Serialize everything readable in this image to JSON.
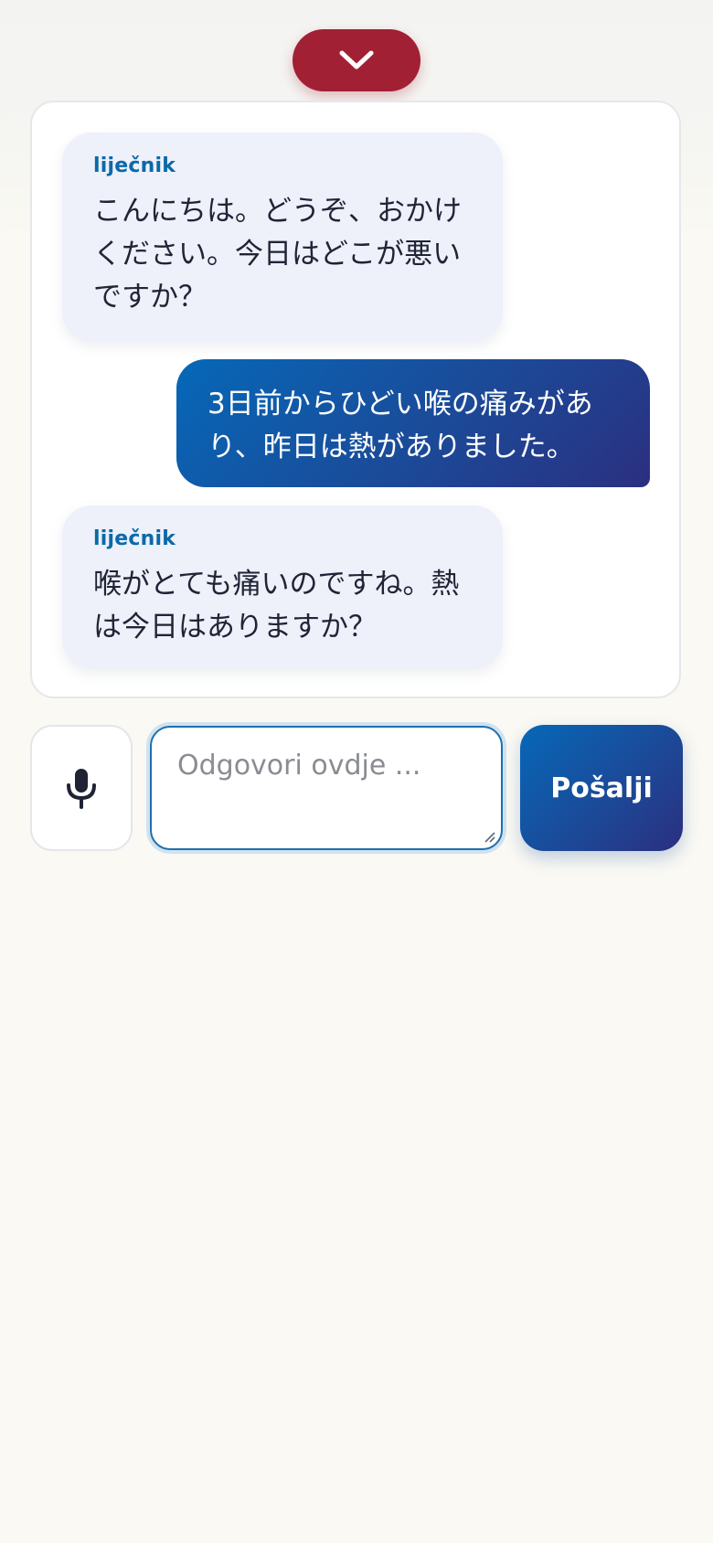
{
  "header": {
    "collapse_icon": "chevron-down-icon",
    "collapse_color": "#a22033"
  },
  "chat": {
    "messages": [
      {
        "role": "doctor",
        "sender": "liječnik",
        "text": "こんにちは。どうぞ、おかけください。今日はどこが悪いですか？"
      },
      {
        "role": "patient",
        "text": "3日前からひどい喉の痛みがあり、昨日は熱がありました。"
      },
      {
        "role": "doctor",
        "sender": "liječnik",
        "text": "喉がとても痛いのですね。熱は今日はありますか？"
      }
    ]
  },
  "composer": {
    "mic_icon": "microphone-icon",
    "placeholder": "Odgovori ovdje ...",
    "value": "",
    "send_label": "Pošalji",
    "accent_color": "#1b4a98"
  }
}
